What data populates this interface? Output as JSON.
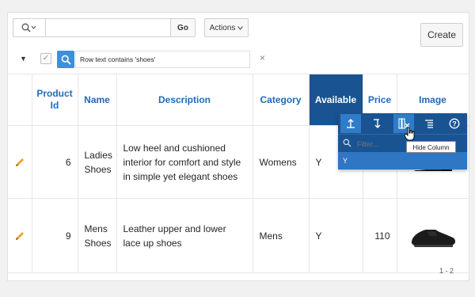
{
  "toolbar": {
    "search_value": "",
    "go_label": "Go",
    "actions_label": "Actions",
    "create_label": "Create"
  },
  "filter": {
    "text": "Row text contains 'shoes'",
    "remove_glyph": "×"
  },
  "table": {
    "headers": [
      "Product Id",
      "Name",
      "Description",
      "Category",
      "Available",
      "Price",
      "Image"
    ],
    "rows": [
      {
        "product_id": "6",
        "name": "Ladies Shoes",
        "description": "Low heel and cushioned interior for comfort and style in simple yet elegant shoes",
        "category": "Womens",
        "available": "Y",
        "price": ""
      },
      {
        "product_id": "9",
        "name": "Mens Shoes",
        "description": "Leather upper and lower lace up shoes",
        "category": "Mens",
        "available": "Y",
        "price": "110"
      }
    ]
  },
  "column_menu": {
    "filter_placeholder": "Filter...",
    "value_item": "Y",
    "tooltip": "Hide Column"
  },
  "pagination": {
    "range": "1 - 2"
  },
  "colors": {
    "accent": "#1f6ab8",
    "menu_bg": "#1a5391",
    "menu_selected": "#2f77c2",
    "filter_icon_bg": "#3d8fd9"
  }
}
